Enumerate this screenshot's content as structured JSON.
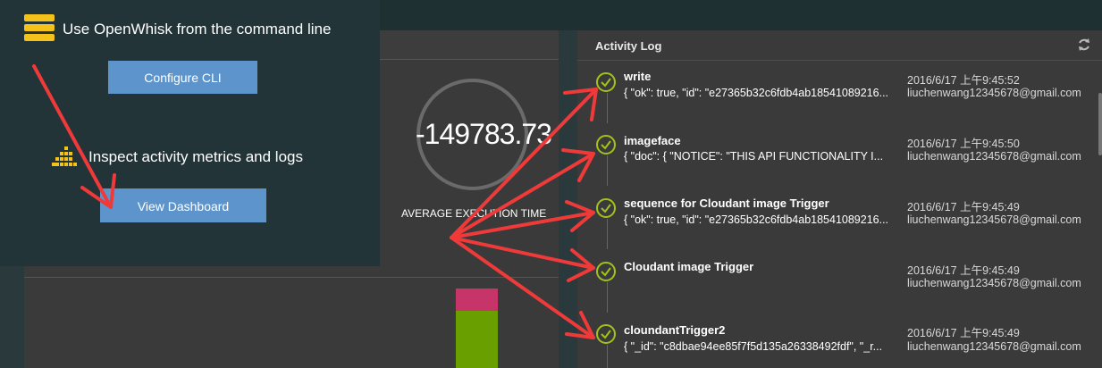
{
  "overlay": {
    "cli_title": "Use OpenWhisk from the command line",
    "configure_label": "Configure CLI",
    "dashboard_title": "Inspect activity metrics and logs",
    "view_label": "View Dashboard"
  },
  "metrics": {
    "average_value": "-149783.73",
    "average_label": "AVERAGE EXECUTION TIME"
  },
  "log": {
    "title": "Activity Log",
    "entries": [
      {
        "name": "write",
        "detail": "{ \"ok\": true, \"id\": \"e27365b32c6fdb4ab18541089216...",
        "time": "2016/6/17 上午9:45:52",
        "user": "liuchenwang12345678@gmail.com"
      },
      {
        "name": "imageface",
        "detail": "{ \"doc\": { \"NOTICE\": \"THIS API FUNCTIONALITY I...",
        "time": "2016/6/17 上午9:45:50",
        "user": "liuchenwang12345678@gmail.com"
      },
      {
        "name": "sequence for Cloudant image Trigger",
        "detail": "{ \"ok\": true, \"id\": \"e27365b32c6fdb4ab18541089216...",
        "time": "2016/6/17 上午9:45:49",
        "user": "liuchenwang12345678@gmail.com"
      },
      {
        "name": "Cloudant image Trigger",
        "detail": "",
        "time": "2016/6/17 上午9:45:49",
        "user": "liuchenwang12345678@gmail.com"
      },
      {
        "name": "cloundantTrigger2",
        "detail": "{ \"_id\": \"c8dbae94ee85f7f5d135a26338492fdf\", \"_r...",
        "time": "2016/6/17 上午9:45:49",
        "user": "liuchenwang12345678@gmail.com"
      }
    ]
  },
  "colors": {
    "accent_button": "#5e94cc",
    "icon_yellow": "#f4c21b",
    "check_green": "#a3c21b",
    "arrow_red": "#f03a3a",
    "bar_pink": "#c7346a",
    "bar_green": "#6a9f00"
  }
}
